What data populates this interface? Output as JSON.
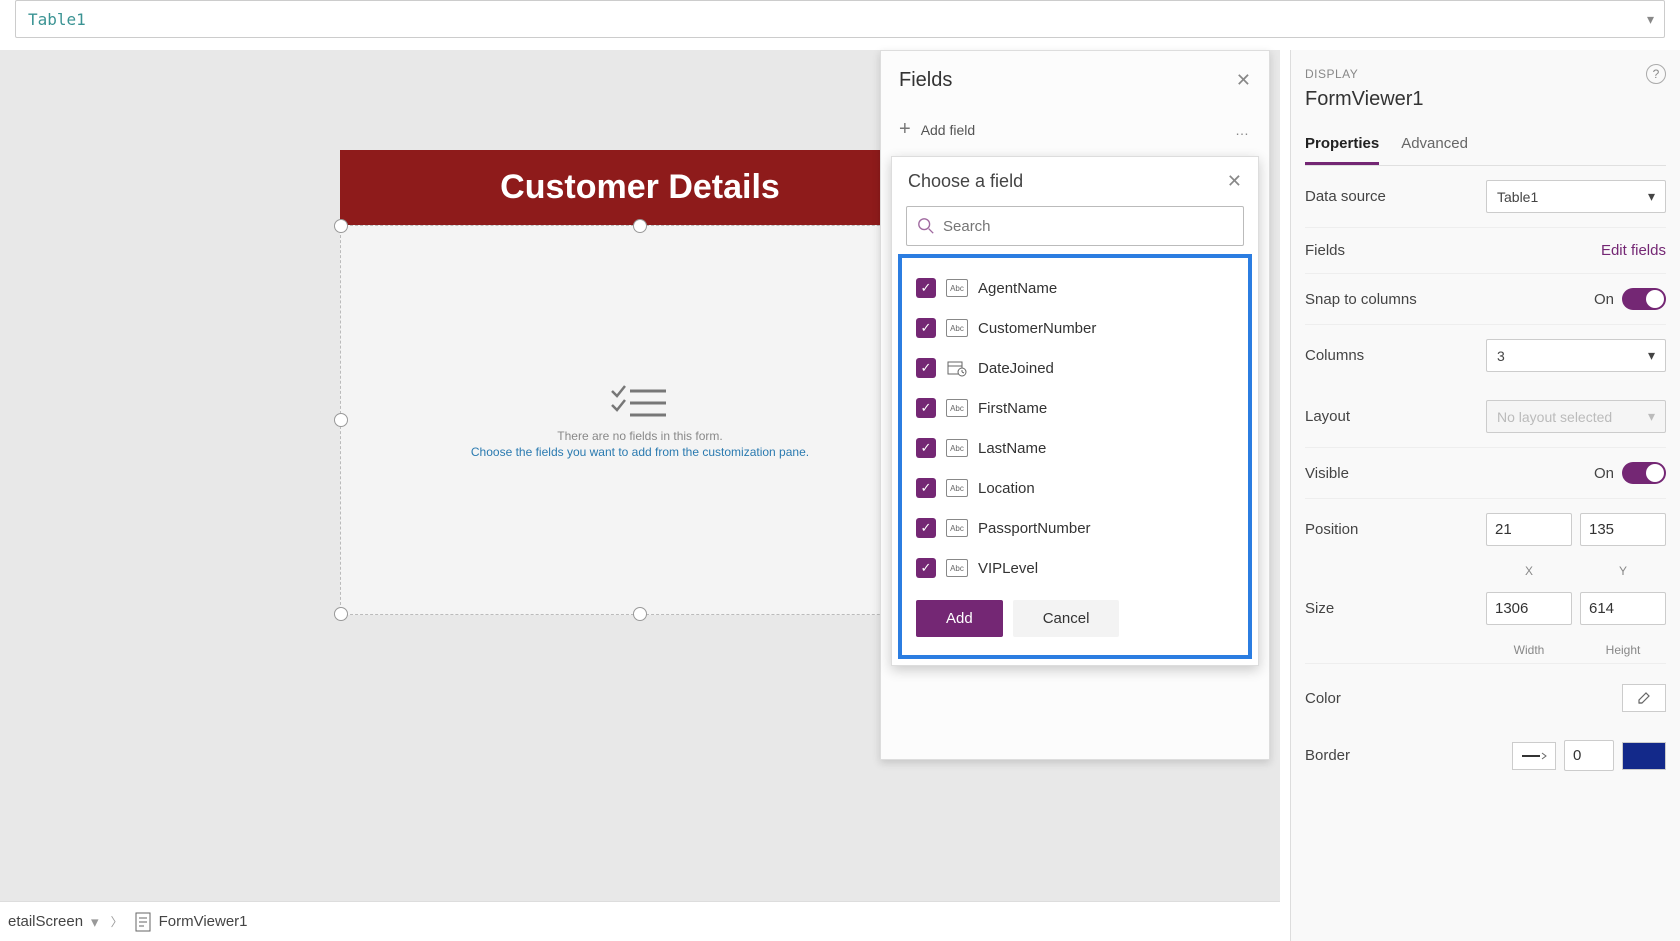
{
  "formula_bar": {
    "text": "Table1"
  },
  "canvas": {
    "header_title": "Customer Details",
    "empty_line1": "There are no fields in this form.",
    "empty_line2": "Choose the fields you want to add from the customization pane."
  },
  "fields_panel": {
    "title": "Fields",
    "add_field_label": "Add field",
    "choose_title": "Choose a field",
    "search_placeholder": "Search",
    "fields": [
      {
        "name": "AgentName",
        "type": "Abc",
        "checked": true
      },
      {
        "name": "CustomerNumber",
        "type": "Abc",
        "checked": true
      },
      {
        "name": "DateJoined",
        "type": "date",
        "checked": true
      },
      {
        "name": "FirstName",
        "type": "Abc",
        "checked": true
      },
      {
        "name": "LastName",
        "type": "Abc",
        "checked": true
      },
      {
        "name": "Location",
        "type": "Abc",
        "checked": true
      },
      {
        "name": "PassportNumber",
        "type": "Abc",
        "checked": true
      },
      {
        "name": "VIPLevel",
        "type": "Abc",
        "checked": true
      }
    ],
    "add_button": "Add",
    "cancel_button": "Cancel"
  },
  "props_panel": {
    "display_label": "DISPLAY",
    "object_name": "FormViewer1",
    "tabs": {
      "properties": "Properties",
      "advanced": "Advanced"
    },
    "data_source_label": "Data source",
    "data_source_value": "Table1",
    "fields_label": "Fields",
    "edit_fields_link": "Edit fields",
    "snap_label": "Snap to columns",
    "columns_label": "Columns",
    "columns_value": "3",
    "layout_label": "Layout",
    "layout_placeholder": "No layout selected",
    "visible_label": "Visible",
    "on_label": "On",
    "position_label": "Position",
    "position_x": "21",
    "position_y": "135",
    "position_xlabel": "X",
    "position_ylabel": "Y",
    "size_label": "Size",
    "size_width": "1306",
    "size_height": "614",
    "size_wlabel": "Width",
    "size_hlabel": "Height",
    "color_label": "Color",
    "border_label": "Border",
    "border_width": "0"
  },
  "breadcrumb": {
    "screen_name": "etailScreen",
    "control_name": "FormViewer1"
  }
}
